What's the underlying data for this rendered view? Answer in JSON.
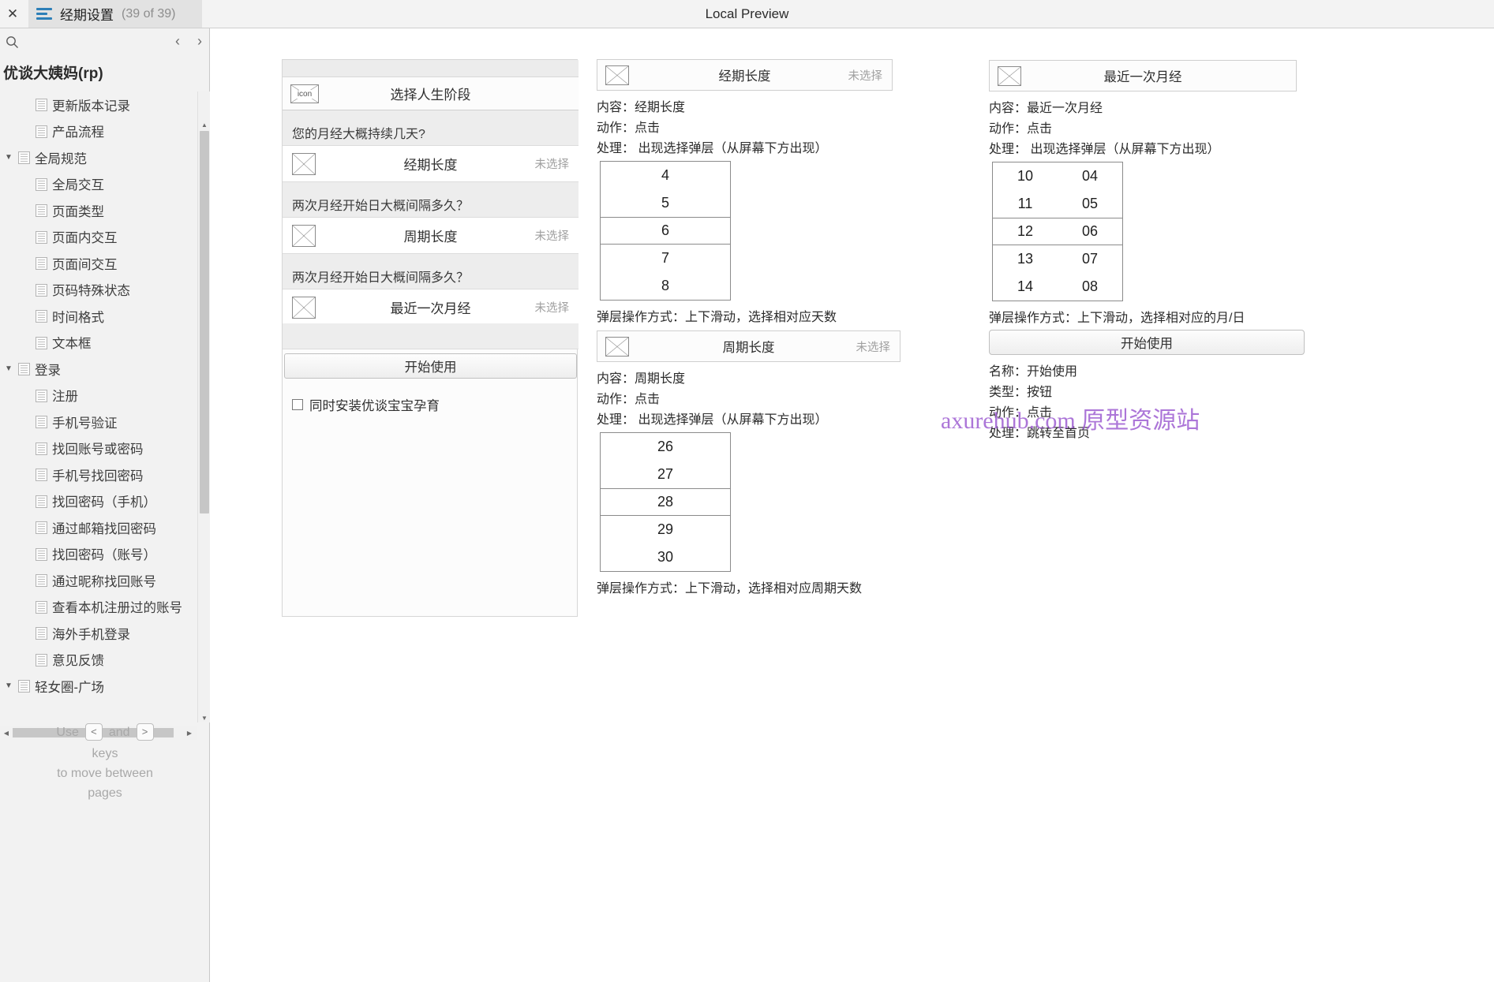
{
  "window": {
    "app_title": "Local Preview",
    "close_label": "✕"
  },
  "tab": {
    "icon": "list-menu-icon",
    "title": "经期设置",
    "count": "(39 of 39)"
  },
  "sidebar": {
    "search_icon": "search-icon",
    "prev_label": "‹",
    "next_label": "›",
    "project_title": "优谈大姨妈(rp)",
    "tree": [
      {
        "label": "更新版本记录",
        "depth": 1,
        "twisty": ""
      },
      {
        "label": "产品流程",
        "depth": 1,
        "twisty": ""
      },
      {
        "label": "全局规范",
        "depth": 0,
        "twisty": "▼"
      },
      {
        "label": "全局交互",
        "depth": 1,
        "twisty": ""
      },
      {
        "label": "页面类型",
        "depth": 1,
        "twisty": ""
      },
      {
        "label": "页面内交互",
        "depth": 1,
        "twisty": ""
      },
      {
        "label": "页面间交互",
        "depth": 1,
        "twisty": ""
      },
      {
        "label": "页码特殊状态",
        "depth": 1,
        "twisty": ""
      },
      {
        "label": "时间格式",
        "depth": 1,
        "twisty": ""
      },
      {
        "label": "文本框",
        "depth": 1,
        "twisty": ""
      },
      {
        "label": "登录",
        "depth": 0,
        "twisty": "▼"
      },
      {
        "label": "注册",
        "depth": 1,
        "twisty": ""
      },
      {
        "label": "手机号验证",
        "depth": 1,
        "twisty": ""
      },
      {
        "label": "找回账号或密码",
        "depth": 1,
        "twisty": ""
      },
      {
        "label": "手机号找回密码",
        "depth": 1,
        "twisty": ""
      },
      {
        "label": "找回密码（手机）",
        "depth": 1,
        "twisty": ""
      },
      {
        "label": "通过邮箱找回密码",
        "depth": 1,
        "twisty": ""
      },
      {
        "label": "找回密码（账号）",
        "depth": 1,
        "twisty": ""
      },
      {
        "label": "通过昵称找回账号",
        "depth": 1,
        "twisty": ""
      },
      {
        "label": "查看本机注册过的账号",
        "depth": 1,
        "twisty": ""
      },
      {
        "label": "海外手机登录",
        "depth": 1,
        "twisty": ""
      },
      {
        "label": "意见反馈",
        "depth": 1,
        "twisty": ""
      },
      {
        "label": "轻女圈-广场",
        "depth": 0,
        "twisty": "▼"
      }
    ],
    "help": {
      "use": "Use",
      "key_prev": "<",
      "and": "and",
      "key_next": ">",
      "line2": "keys",
      "line3": "to move between",
      "line4": "pages"
    }
  },
  "phone": {
    "nav_icon": "image-placeholder-icon",
    "nav_icon_label": "icon",
    "nav_title": "选择人生阶段",
    "sections": [
      {
        "question": "您的月经大概持续几天?",
        "row_icon": "image-placeholder-icon",
        "row_name": "经期长度",
        "row_value": "未选择"
      },
      {
        "question": "两次月经开始日大概间隔多久？",
        "row_icon": "image-placeholder-icon",
        "row_name": "周期长度",
        "row_value": "未选择"
      },
      {
        "question": "两次月经开始日大概间隔多久？",
        "row_icon": "image-placeholder-icon",
        "row_name": "最近一次月经",
        "row_value": "未选择"
      }
    ],
    "start_button": "开始使用",
    "install_checkbox_label": "同时安装优谈宝宝孕育"
  },
  "annotations": [
    {
      "id": "period-length",
      "header_icon": "image-placeholder-icon",
      "header_title": "经期长度",
      "header_value": "未选择",
      "lines": [
        "内容：经期长度",
        "动作：点击",
        "处理： 出现选择弹层（从屏幕下方出现）"
      ],
      "picker": {
        "columns": [
          [
            "4",
            "5",
            "6",
            "7",
            "8"
          ]
        ],
        "selected_index": 2
      },
      "footer": "弹层操作方式：上下滑动，选择相对应天数"
    },
    {
      "id": "cycle-length",
      "header_icon": "image-placeholder-icon",
      "header_title": "周期长度",
      "header_value": "未选择",
      "lines": [
        "内容：周期长度",
        "动作：点击",
        "处理： 出现选择弹层（从屏幕下方出现）"
      ],
      "picker": {
        "columns": [
          [
            "26",
            "27",
            "28",
            "29",
            "30"
          ]
        ],
        "selected_index": 2
      },
      "footer": "弹层操作方式：上下滑动，选择相对应周期天数"
    },
    {
      "id": "last-period",
      "header_icon": "image-placeholder-icon",
      "header_title": "最近一次月经",
      "header_value": "",
      "lines": [
        "内容：最近一次月经",
        "动作：点击",
        "处理： 出现选择弹层（从屏幕下方出现）"
      ],
      "picker": {
        "columns": [
          [
            "10",
            "11",
            "12",
            "13",
            "14"
          ],
          [
            "04",
            "05",
            "06",
            "07",
            "08"
          ]
        ],
        "selected_index": 2
      },
      "footer": "弹层操作方式：上下滑动，选择相对应的月/日"
    }
  ],
  "start_annotation": {
    "button_label": "开始使用",
    "lines": [
      "名称：开始使用",
      "类型：按钮",
      "动作：点击",
      "处理：跳转至首页"
    ]
  },
  "watermark": {
    "text": "axurehub.com 原型资源站",
    "color": "#9b59d0"
  }
}
